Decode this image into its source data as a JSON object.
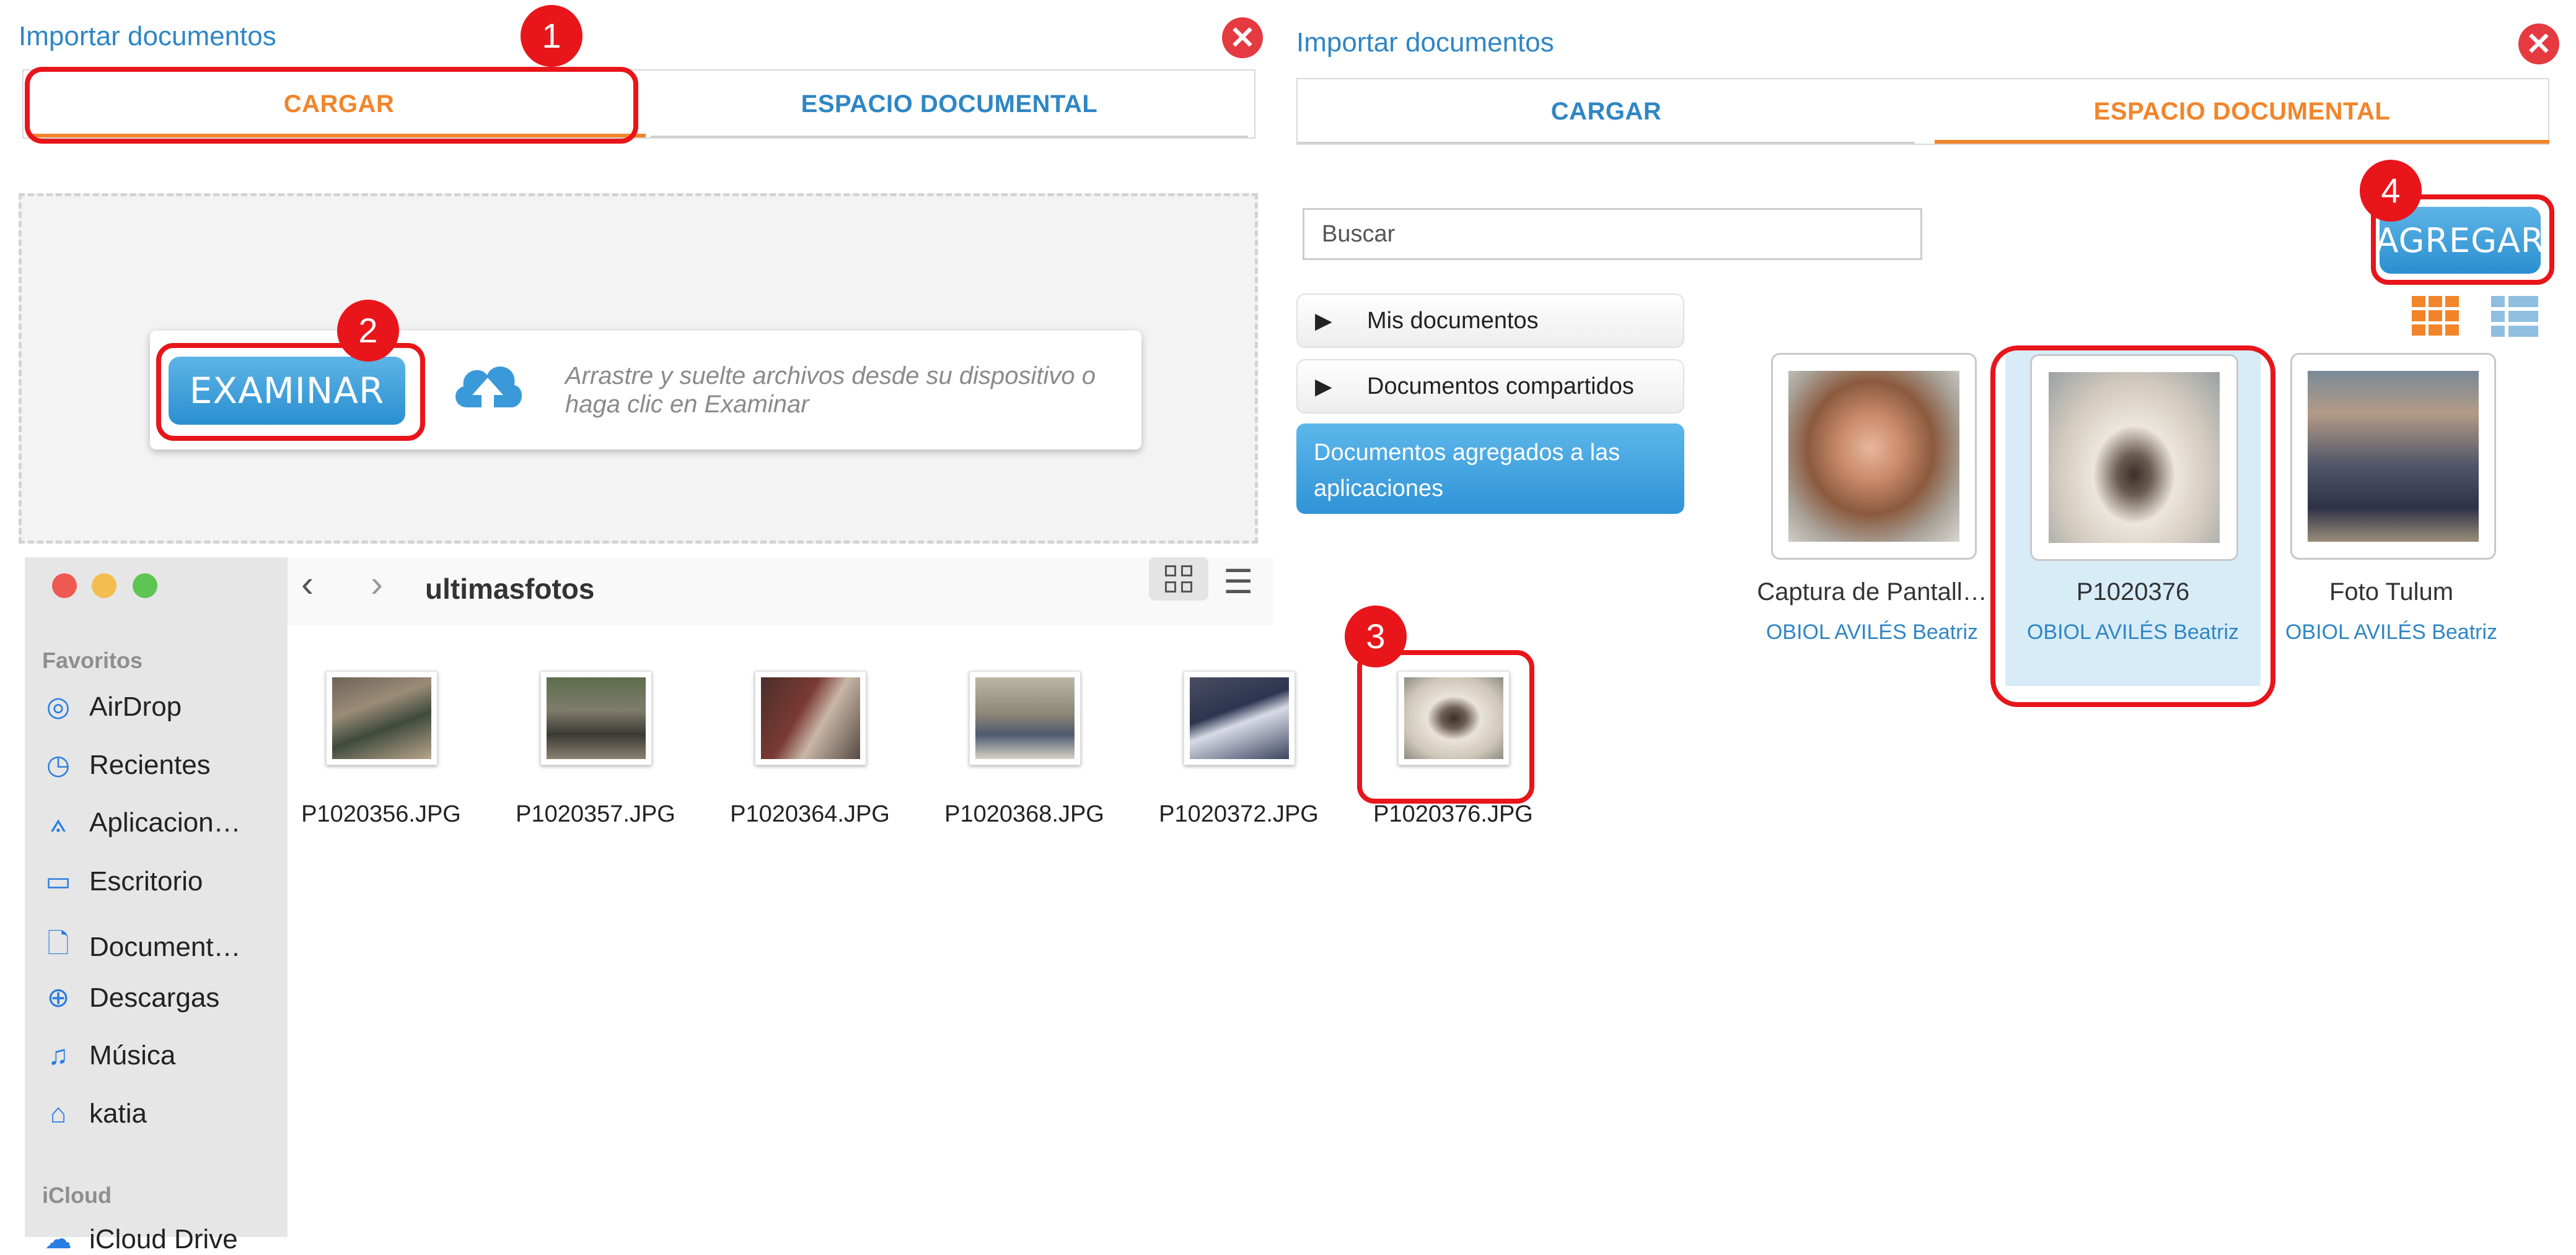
{
  "left_dialog": {
    "title": "Importar documentos",
    "tabs": [
      "CARGAR",
      "ESPACIO DOCUMENTAL"
    ],
    "examine_label": "EXAMINAR",
    "drop_hint": "Arrastre y suelte archivos desde su dispositivo o haga clic en Examinar"
  },
  "right_dialog": {
    "title": "Importar documentos",
    "tabs": [
      "CARGAR",
      "ESPACIO DOCUMENTAL"
    ],
    "search_placeholder": "Buscar",
    "add_label": "AGREGAR",
    "tree": [
      "Mis documentos",
      "Documentos compartidos",
      "Documentos agregados a las aplicaciones"
    ],
    "documents": [
      {
        "name": "Captura de Pantall…",
        "owner": "OBIOL AVILÉS Beatriz"
      },
      {
        "name": "P1020376",
        "owner": "OBIOL AVILÉS Beatriz"
      },
      {
        "name": "Foto Tulum",
        "owner": "OBIOL AVILÉS Beatriz"
      }
    ]
  },
  "finder": {
    "folder": "ultimasfotos",
    "sidebar": {
      "favorites_heading": "Favoritos",
      "items": [
        "AirDrop",
        "Recientes",
        "Aplicacion…",
        "Escritorio",
        "Document…",
        "Descargas",
        "Música",
        "katia"
      ],
      "icloud_heading": "iCloud",
      "icloud_partial": "iCloud Drive"
    },
    "files": [
      "P1020356.JPG",
      "P1020357.JPG",
      "P1020364.JPG",
      "P1020368.JPG",
      "P1020372.JPG",
      "P1020376.JPG"
    ]
  },
  "steps": [
    "1",
    "2",
    "3",
    "4"
  ],
  "colors": {
    "accent_blue": "#2f86c4",
    "accent_orange": "#f2852a",
    "marker_red": "#e8151b",
    "close_red": "#e53a40"
  }
}
